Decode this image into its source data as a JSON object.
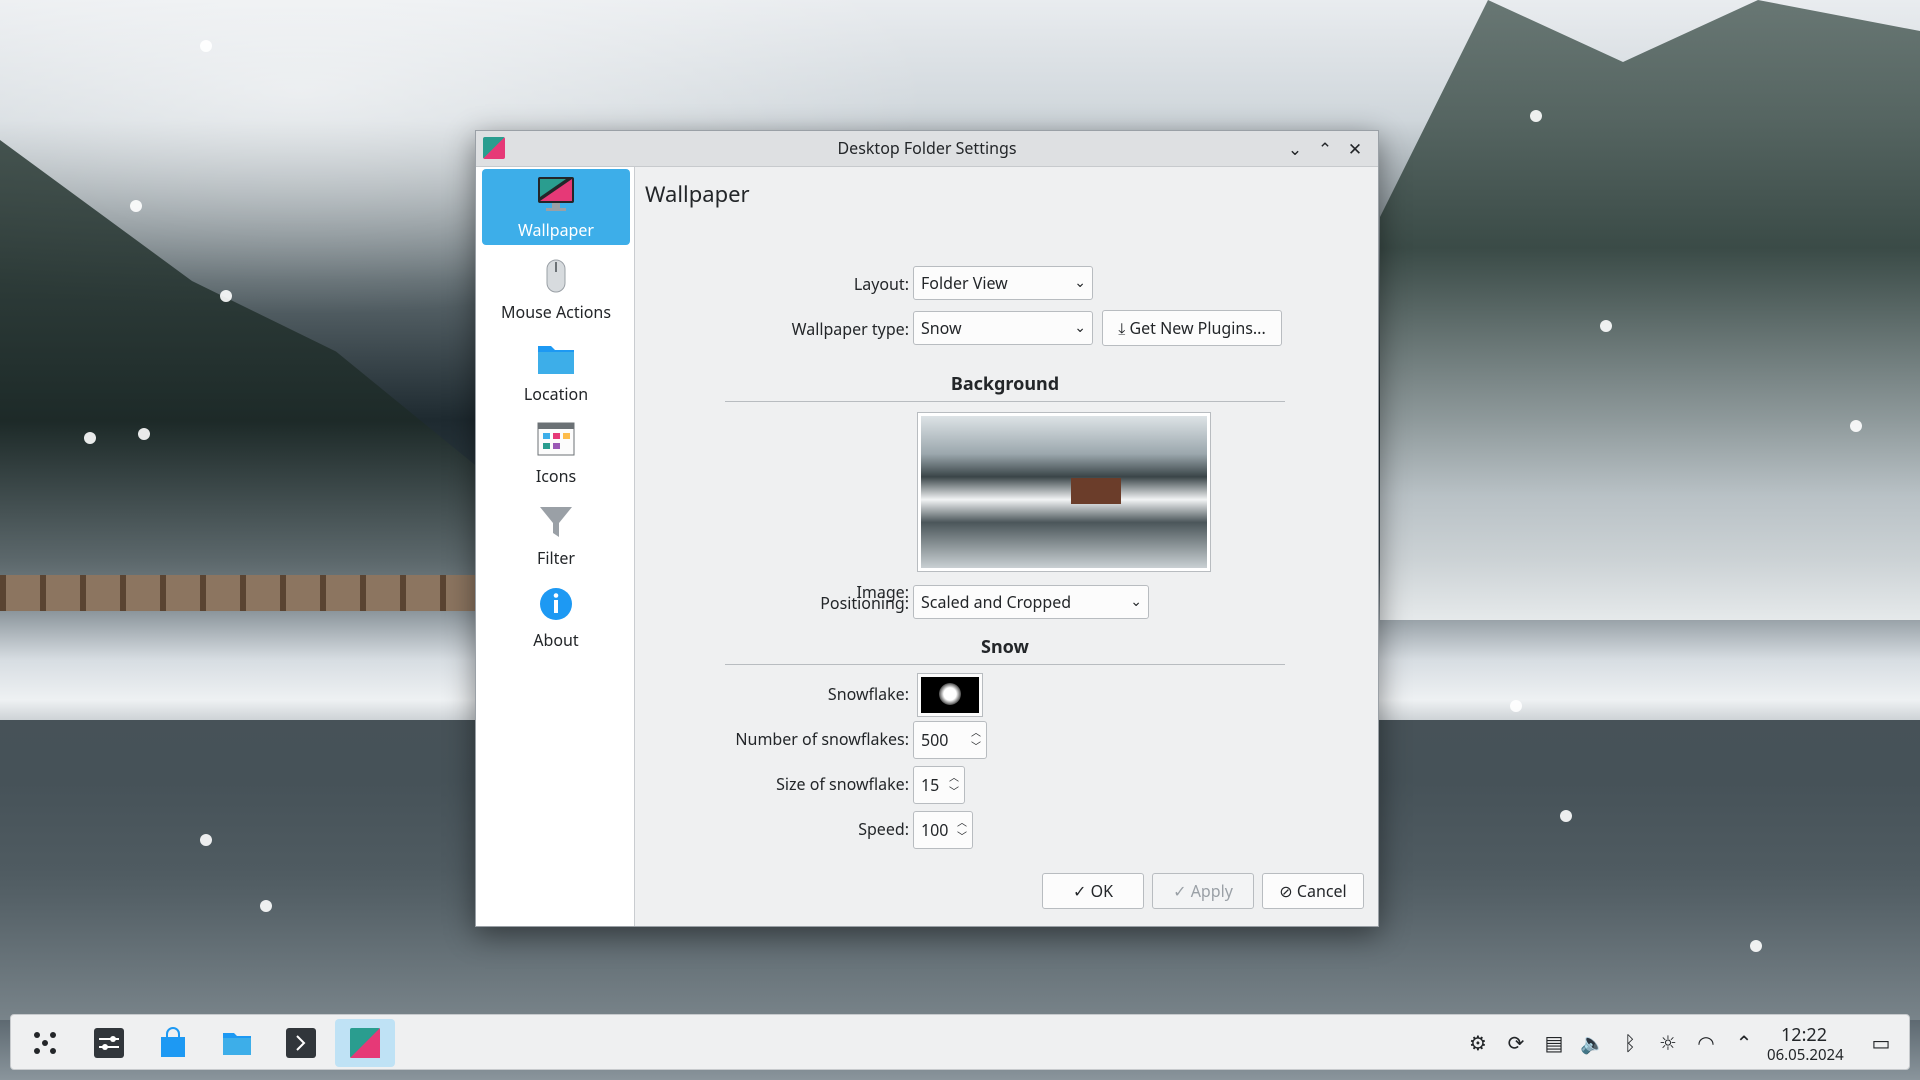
{
  "window": {
    "title": "Desktop Folder Settings",
    "buttons": {
      "minimize": "⌄",
      "maximize": "⌃",
      "close": "✕"
    }
  },
  "sidebar": {
    "items": [
      {
        "label": "Wallpaper",
        "icon": "monitor-icon",
        "active": true
      },
      {
        "label": "Mouse Actions",
        "icon": "mouse-icon",
        "active": false
      },
      {
        "label": "Location",
        "icon": "folder-icon",
        "active": false
      },
      {
        "label": "Icons",
        "icon": "icons-grid-icon",
        "active": false
      },
      {
        "label": "Filter",
        "icon": "filter-funnel-icon",
        "active": false
      },
      {
        "label": "About",
        "icon": "info-icon",
        "active": false
      }
    ]
  },
  "main": {
    "title": "Wallpaper",
    "layout": {
      "label": "Layout:",
      "value": "Folder View"
    },
    "wallpaper_type": {
      "label": "Wallpaper type:",
      "value": "Snow"
    },
    "get_plugins": "Get New Plugins...",
    "background": {
      "heading": "Background",
      "image_label": "Image:",
      "positioning_label": "Positioning:",
      "positioning_value": "Scaled and Cropped"
    },
    "snow": {
      "heading": "Snow",
      "snowflake_label": "Snowflake:",
      "count_label": "Number of snowflakes:",
      "count_value": "500",
      "size_label": "Size of snowflake:",
      "size_value": "15",
      "speed_label": "Speed:",
      "speed_value": "100"
    },
    "buttons": {
      "ok": "OK",
      "apply": "Apply",
      "cancel": "Cancel"
    }
  },
  "taskbar": {
    "apps": [
      "app-launcher-icon",
      "system-settings-icon",
      "discover-store-icon",
      "file-manager-icon",
      "terminal-icon",
      "desktop-settings-icon"
    ],
    "tray": [
      "activity-icon",
      "updates-icon",
      "clipboard-icon",
      "volume-icon",
      "bluetooth-icon",
      "brightness-icon",
      "wifi-icon",
      "expand-tray-icon"
    ],
    "time": "12:22",
    "date": "06.05.2024"
  },
  "colors": {
    "accent": "#3daee9",
    "window_bg": "#eff0f1",
    "sidebar_bg": "#ffffff"
  }
}
